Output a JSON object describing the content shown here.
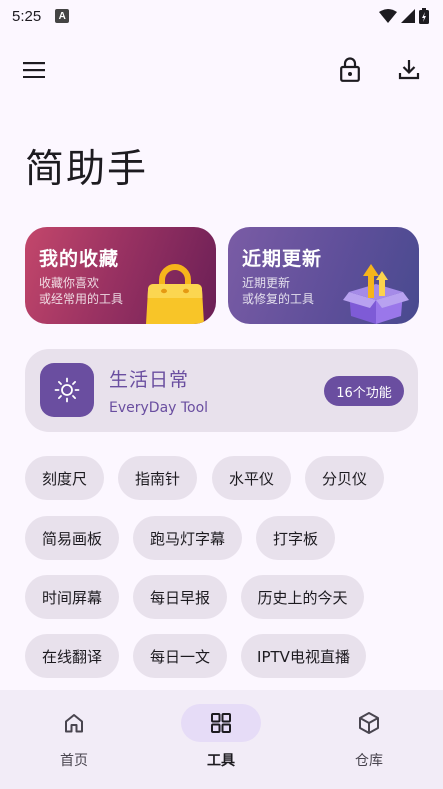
{
  "status": {
    "time": "5:25",
    "notif_letter": "A"
  },
  "header": {
    "title": "简助手"
  },
  "cards": {
    "favorites": {
      "title": "我的收藏",
      "desc_line1": "收藏你喜欢",
      "desc_line2": "或经常用的工具"
    },
    "updates": {
      "title": "近期更新",
      "desc_line1": "近期更新",
      "desc_line2": "或修复的工具"
    }
  },
  "category": {
    "title": "生活日常",
    "subtitle": "EveryDay Tool",
    "badge": "16个功能"
  },
  "tools": [
    "刻度尺",
    "指南针",
    "水平仪",
    "分贝仪",
    "简易画板",
    "跑马灯字幕",
    "打字板",
    "时间屏幕",
    "每日早报",
    "历史上的今天",
    "在线翻译",
    "每日一文",
    "IPTV电视直播"
  ],
  "nav": {
    "items": [
      {
        "label": "首页",
        "icon": "home-icon",
        "active": false
      },
      {
        "label": "工具",
        "icon": "grid-icon",
        "active": true
      },
      {
        "label": "仓库",
        "icon": "cube-icon",
        "active": false
      }
    ]
  },
  "colors": {
    "accent": "#6a4ea0",
    "background": "#fcf7ff",
    "chip": "#e8e1ec"
  }
}
